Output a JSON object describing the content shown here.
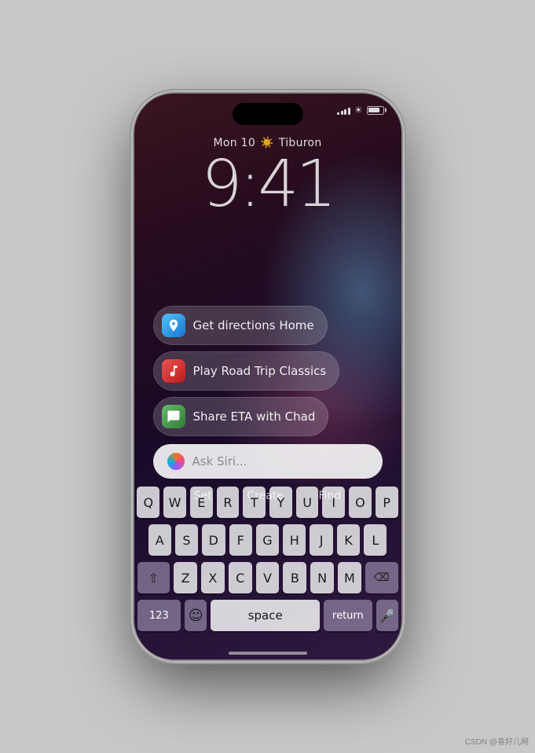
{
  "phone": {
    "statusBar": {
      "signal": "4 bars",
      "wifi": "wifi",
      "battery": "battery"
    },
    "lockscreen": {
      "date": "Mon 10",
      "location": "Tiburon",
      "time": "9:41"
    },
    "suggestions": [
      {
        "id": "directions",
        "icon": "maps",
        "label": "Get directions Home"
      },
      {
        "id": "music",
        "icon": "music",
        "label": "Play Road Trip Classics"
      },
      {
        "id": "messages",
        "icon": "messages",
        "label": "Share ETA with Chad"
      }
    ],
    "siri": {
      "placeholder": "Ask Siri..."
    },
    "shortcuts": [
      "Set",
      "Create",
      "Find"
    ],
    "keyboard": {
      "row1": [
        "Q",
        "W",
        "E",
        "R",
        "T",
        "Y",
        "U",
        "I",
        "O",
        "P"
      ],
      "row2": [
        "A",
        "S",
        "D",
        "F",
        "G",
        "H",
        "J",
        "K",
        "L"
      ],
      "row3": [
        "Z",
        "X",
        "C",
        "V",
        "B",
        "N",
        "M"
      ],
      "bottomLeft": "123",
      "space": "space",
      "bottomRight": "return",
      "shift": "⇧",
      "delete": "⌫"
    }
  }
}
